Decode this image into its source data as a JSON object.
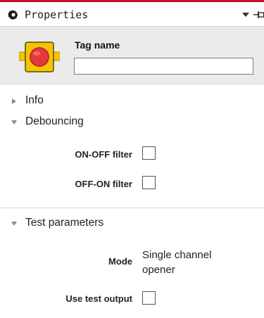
{
  "header": {
    "title": "Properties",
    "icons": [
      "gear-icon",
      "dropdown-icon",
      "pin-icon"
    ]
  },
  "tag": {
    "label": "Tag name",
    "value": "",
    "placeholder": "",
    "icon": "device-icon"
  },
  "sections": {
    "info": {
      "label": "Info",
      "expanded": false
    },
    "debouncing": {
      "label": "Debouncing",
      "expanded": true,
      "on_off_filter": {
        "label": "ON-OFF filter",
        "checked": false
      },
      "off_on_filter": {
        "label": "OFF-ON filter",
        "checked": false
      }
    },
    "test_parameters": {
      "label": "Test parameters",
      "expanded": true,
      "mode": {
        "label": "Mode",
        "value_line1": "Single channel",
        "value_line2": "opener"
      },
      "use_test_output": {
        "label": "Use test output",
        "checked": false
      }
    }
  },
  "colors": {
    "accent": "#c8102e",
    "device_yellow": "#f5c400",
    "device_red": "#e23a3a",
    "tagbox_bg": "#ebebeb"
  }
}
